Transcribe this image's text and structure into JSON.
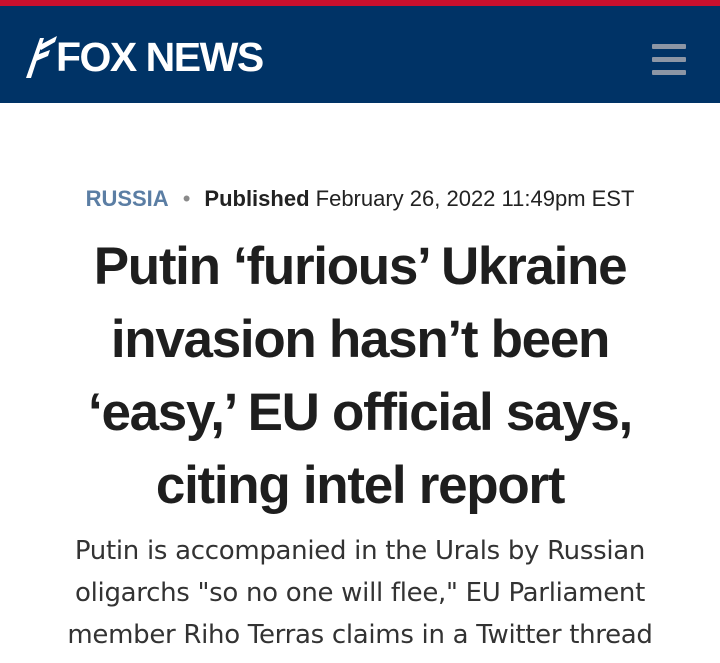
{
  "brand": {
    "name": "FOX NEWS",
    "stripe_color": "#c8102e",
    "header_color": "#003366"
  },
  "header": {
    "menu_icon": "hamburger-menu-icon"
  },
  "article": {
    "category": "RUSSIA",
    "separator": "•",
    "published_label": "Published",
    "published_date": "February 26, 2022 11:49pm EST",
    "headline": "Putin ‘furious’ Ukraine invasion hasn’t been ‘easy,’ EU official says, citing intel report",
    "subhead": "Putin is accompanied in the Urals by Russian oligarchs \"so no one will flee,\" EU Parliament member Riho Terras claims in a Twitter thread"
  }
}
